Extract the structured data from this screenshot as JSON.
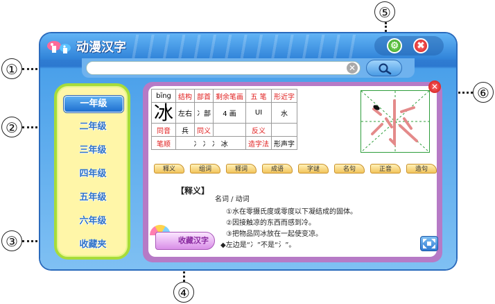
{
  "app": {
    "title": "动漫汉字",
    "close_symbol": "✖",
    "settings_symbol": "⚙"
  },
  "search": {
    "value": "",
    "clear_symbol": "✕"
  },
  "grades": [
    "一年级",
    "二年级",
    "三年级",
    "四年级",
    "五年级",
    "六年级",
    "收藏夹"
  ],
  "active_grade": "一年级",
  "character": {
    "pinyin": "bīng",
    "char": "冰",
    "structure_label": "结构",
    "structure": "左右",
    "radical_label": "部首",
    "radical": "冫部",
    "remaining_strokes_label": "剩余笔画",
    "remaining_strokes": "4 画",
    "wubi_label": "五 笔",
    "wubi": "UI",
    "similar_label": "形近字",
    "similar": "水",
    "homophone_label": "同音",
    "homophone": "兵",
    "synonym_label": "同义",
    "synonym": "",
    "antonym_label": "反义",
    "antonym": "",
    "stroke_order_label": "笔顺",
    "stroke_order": "冫 冫 冫 冰",
    "formation_label": "造字法",
    "formation": "形声字"
  },
  "tabs": [
    "释义",
    "组词",
    "释词",
    "成语",
    "字谜",
    "名句",
    "正音",
    "造句"
  ],
  "definition": {
    "heading": "【释义】",
    "pos": "名词 / 动词",
    "lines": [
      "①水在零摄氏度或零度以下凝结成的固体。",
      "②因接触凉的东西而感到冷。",
      "③把物品同冰放在一起使变凉。",
      "◆左边是“冫”不是“氵”。"
    ]
  },
  "favorite_button": "收藏汉字",
  "close_panel_symbol": "✕",
  "callouts": [
    "①",
    "②",
    "③",
    "④",
    "⑤",
    "⑥"
  ]
}
